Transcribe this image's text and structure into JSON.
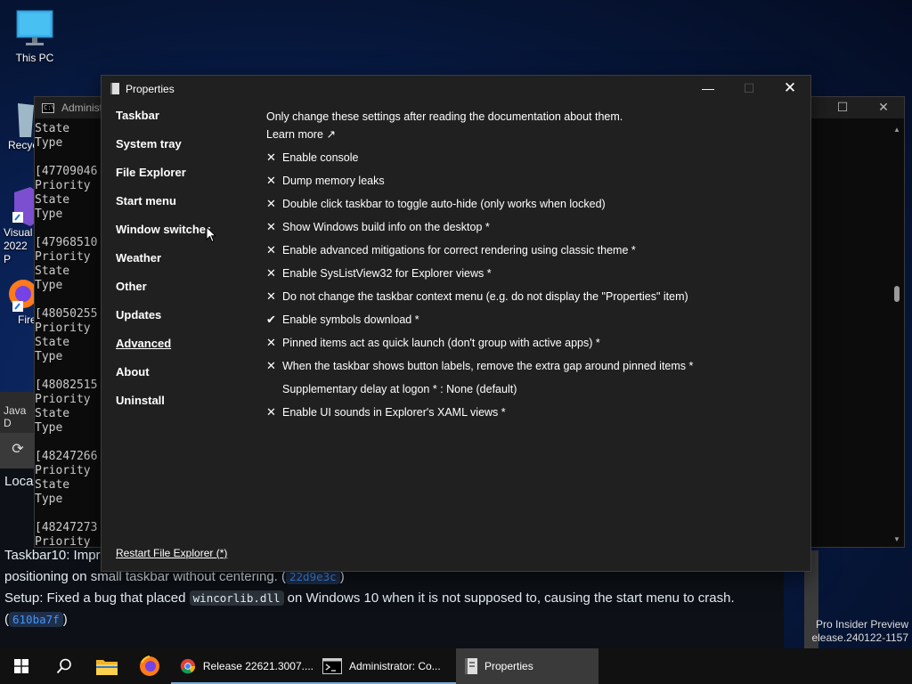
{
  "desktop": {
    "icons": [
      {
        "label": "This PC"
      },
      {
        "label": "Recyc"
      },
      {
        "label": "Visual 2022 P"
      },
      {
        "label": "Fire"
      }
    ]
  },
  "console": {
    "title": "Administ",
    "lines": "State\nType\n\n[47709046\nPriority\nState\nType\n\n[47968510\nPriority\nState\nType\n\n[48050255\nPriority\nState\nType\n\n[48082515\nPriority\nState\nType\n\n[48247266\nPriority\nState\nType\n\n[48247273\nPriority"
  },
  "browser": {
    "java_tab": "Java D",
    "loca": "Loca",
    "note1_a": "Taskbar10: Impr",
    "note1_b": "positioning on small taskbar without centering. (",
    "note1_commit": "22d9e3c",
    "note1_end": ")",
    "note2_a": "Setup: Fixed a bug that placed ",
    "note2_code": "wincorlib.dll",
    "note2_b": " on Windows 10 when it is not supposed to, causing the start menu to crash. (",
    "note2_commit": "610ba7f",
    "note2_end": ")",
    "watermark_line1": "Pro Insider Preview",
    "watermark_line2": "elease.240122-1157"
  },
  "properties": {
    "title": "Properties",
    "nav": [
      {
        "label": "Taskbar"
      },
      {
        "label": "System tray"
      },
      {
        "label": "File Explorer"
      },
      {
        "label": "Start menu"
      },
      {
        "label": "Window switcher"
      },
      {
        "label": "Weather"
      },
      {
        "label": "Other"
      },
      {
        "label": "Updates"
      },
      {
        "label": "Advanced",
        "active": true
      },
      {
        "label": "About"
      },
      {
        "label": "Uninstall"
      }
    ],
    "intro": "Only change these settings after reading the documentation about them.",
    "learn_more": "Learn more ↗",
    "options": [
      {
        "mark": "✕",
        "label": "Enable console"
      },
      {
        "mark": "✕",
        "label": "Dump memory leaks"
      },
      {
        "mark": "✕",
        "label": "Double click taskbar to toggle auto-hide (only works when locked)"
      },
      {
        "mark": "✕",
        "label": "Show Windows build info on the desktop *"
      },
      {
        "mark": "✕",
        "label": "Enable advanced mitigations for correct rendering using classic theme *"
      },
      {
        "mark": "✕",
        "label": "Enable SysListView32 for Explorer views *"
      },
      {
        "mark": "✕",
        "label": "Do not change the taskbar context menu (e.g. do not display the \"Properties\" item)"
      },
      {
        "mark": "✔",
        "label": "Enable symbols download *"
      },
      {
        "mark": "✕",
        "label": "Pinned items act as quick launch (don't group with active apps) *"
      },
      {
        "mark": "✕",
        "label": "When the taskbar shows button labels, remove the extra gap around pinned items *"
      },
      {
        "mark": "",
        "label": "Supplementary delay at logon * : None (default)"
      },
      {
        "mark": "✕",
        "label": "Enable UI sounds in Explorer's XAML views *"
      }
    ],
    "restart_link": "Restart File Explorer (*)"
  },
  "taskbar": {
    "tasks": [
      {
        "label": "Release 22621.3007...."
      },
      {
        "label": "Administrator: Co..."
      },
      {
        "label": "Properties"
      }
    ]
  }
}
